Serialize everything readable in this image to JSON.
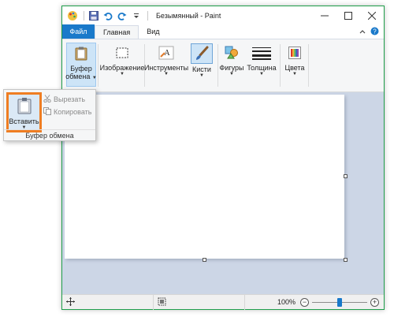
{
  "title": "Безымянный - Paint",
  "tabs": {
    "file": "Файл",
    "home": "Главная",
    "view": "Вид"
  },
  "ribbon": {
    "clipboard": {
      "line1": "Буфер",
      "line2": "обмена"
    },
    "image": "Изображение",
    "tools": "Инструменты",
    "brushes": "Кисти",
    "shapes": "Фигуры",
    "size": "Толщина",
    "colors": "Цвета"
  },
  "flyout": {
    "paste": "Вставить",
    "cut": "Вырезать",
    "copy": "Копировать",
    "group_caption": "Буфер обмена"
  },
  "status": {
    "zoom": "100%",
    "zoom_level": 0.5
  },
  "colors": {
    "accent": "#1979ca",
    "highlight": "#ef7d22",
    "workspace": "#ccd6e6"
  },
  "icons": [
    "paint-app-icon",
    "save-icon",
    "undo-icon",
    "redo-icon",
    "customize-icon",
    "minimize-icon",
    "maximize-icon",
    "close-icon",
    "collapse-ribbon-icon",
    "help-icon",
    "clipboard-icon",
    "select-icon",
    "tools-icon",
    "brush-icon",
    "shapes-icon",
    "size-icon",
    "colors-icon",
    "cut-icon",
    "copy-icon",
    "paste-icon",
    "move-cursor-icon",
    "selection-size-icon",
    "zoom-out-icon",
    "zoom-in-icon"
  ]
}
